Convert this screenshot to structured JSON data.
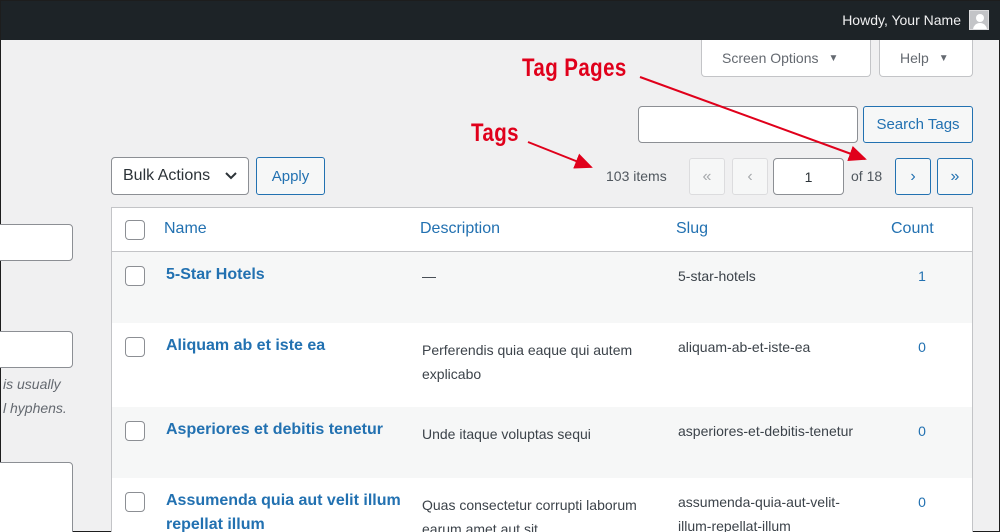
{
  "adminbar": {
    "greeting": "Howdy, Your Name"
  },
  "header": {
    "screen_options": "Screen Options",
    "help": "Help",
    "dropdown_arrow": "▼"
  },
  "search": {
    "value": "",
    "button": "Search Tags"
  },
  "bulk": {
    "selected": "Bulk Actions",
    "apply": "Apply"
  },
  "pagination": {
    "items": "103 items",
    "first": "«",
    "prev": "‹",
    "current_page": "1",
    "of_pages": "of 18",
    "next": "›",
    "last": "»"
  },
  "left_form": {
    "hint_line1": "is usually",
    "hint_line2": "l hyphens."
  },
  "table": {
    "columns": {
      "name": "Name",
      "description": "Description",
      "slug": "Slug",
      "count": "Count"
    },
    "rows": [
      {
        "name": "5-Star Hotels",
        "description": "—",
        "slug": "5-star-hotels",
        "count": "1"
      },
      {
        "name": "Aliquam ab et iste ea",
        "description": "Perferendis quia eaque qui autem explicabo",
        "slug": "aliquam-ab-et-iste-ea",
        "count": "0"
      },
      {
        "name": "Asperiores et debitis tenetur",
        "description": "Unde itaque voluptas sequi",
        "slug": "asperiores-et-debitis-tenetur",
        "count": "0"
      },
      {
        "name": "Assumenda quia aut velit illum repellat illum",
        "description": "Quas consectetur corrupti laborum earum amet aut sit",
        "slug": "assumenda-quia-aut-velit-illum-repellat-illum",
        "count": "0"
      }
    ]
  },
  "annotations": {
    "tag_pages": "Tag Pages",
    "tags": "Tags",
    "color": "#e0001b"
  }
}
